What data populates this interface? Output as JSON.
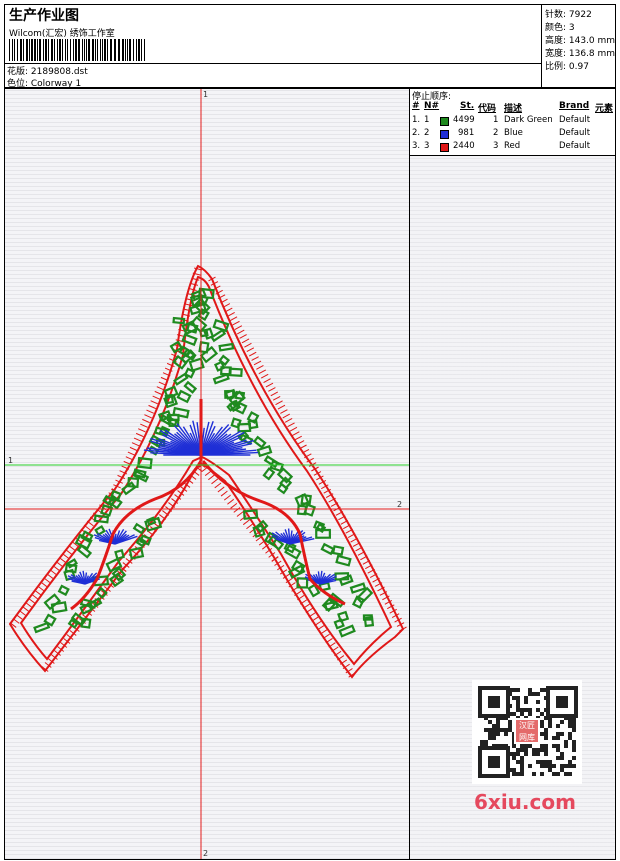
{
  "header": {
    "title": "生产作业图",
    "subtitle": "Wilcom(汇宏) 绣饰工作室",
    "design_label": "花版: 2189808.dst",
    "colorway_label": "色位: Colorway 1"
  },
  "stats": {
    "stitches": "针数: 7922",
    "colors": "颜色: 3",
    "height": "高度: 143.0 mm",
    "width": "宽度: 136.8 mm",
    "scale": "比例: 0.97"
  },
  "canvas": {
    "axis_top": "1",
    "axis_bottom": "2",
    "axis_left": "1",
    "axis_right": "2"
  },
  "stop_sequence": {
    "title": "停止顺序:",
    "headers": [
      "#",
      "N#",
      "St.",
      "代码",
      "描述",
      "Brand",
      "元素"
    ],
    "rows": [
      {
        "num": "1.",
        "n": "1",
        "color": "#1f8a1f",
        "stitches": "4499",
        "code": "1",
        "desc": "Dark Green",
        "brand": "Default"
      },
      {
        "num": "2.",
        "n": "2",
        "color": "#1f2fd6",
        "stitches": "981",
        "code": "2",
        "desc": "Blue",
        "brand": "Default"
      },
      {
        "num": "3.",
        "n": "3",
        "color": "#e01818",
        "stitches": "2440",
        "code": "3",
        "desc": "Red",
        "brand": "Default"
      }
    ]
  },
  "watermark": {
    "qr_badge": "汉匠网库",
    "logo_text": "6xiu.com"
  },
  "colors": {
    "red_axis": "#e31b1b",
    "green_axis": "#2ad12a",
    "green": "#1f8a1f",
    "blue": "#1f2fd6",
    "red": "#e01818"
  }
}
